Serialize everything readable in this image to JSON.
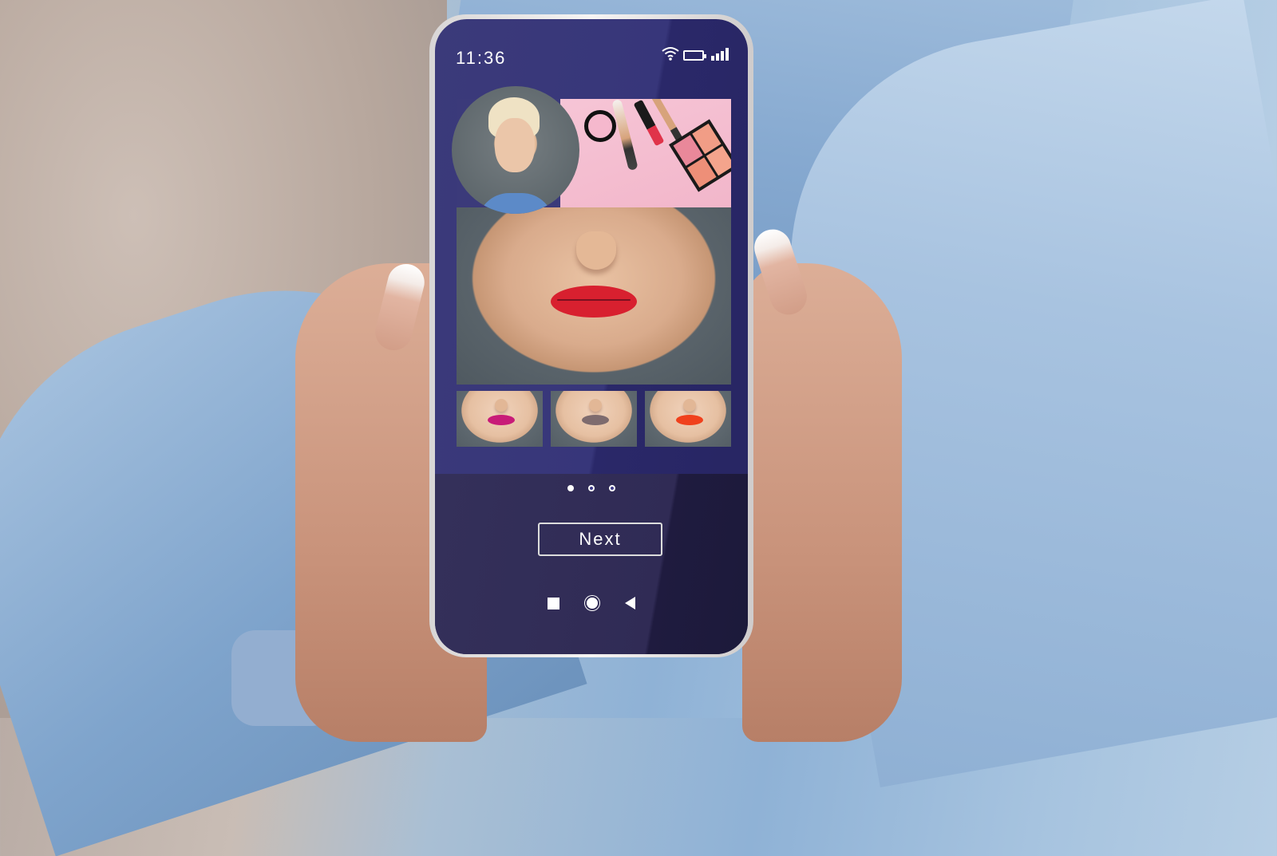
{
  "status_bar": {
    "time": "11:36",
    "icons": [
      "wifi-icon",
      "battery-icon",
      "signal-icon"
    ]
  },
  "app": {
    "hero": {
      "description": "Virtual makeup try-on: user portrait, cosmetics flatlay and lower face preview with red lipstick",
      "applied_lip_color": "#d8202f"
    },
    "swatches": [
      {
        "label": "Magenta",
        "color": "#c81b78"
      },
      {
        "label": "Taupe",
        "color": "#7e6b6e"
      },
      {
        "label": "Orange Red",
        "color": "#f0401c"
      }
    ],
    "pagination": {
      "current": 1,
      "total": 3
    },
    "next_label": "Next"
  },
  "nav_bar": {
    "items": [
      "recents-square-icon",
      "home-circle-icon",
      "back-triangle-icon"
    ]
  },
  "colors": {
    "screen_bg": "#37367a",
    "screen_lower_bg": "#302b55",
    "accent": "#ffffff"
  }
}
